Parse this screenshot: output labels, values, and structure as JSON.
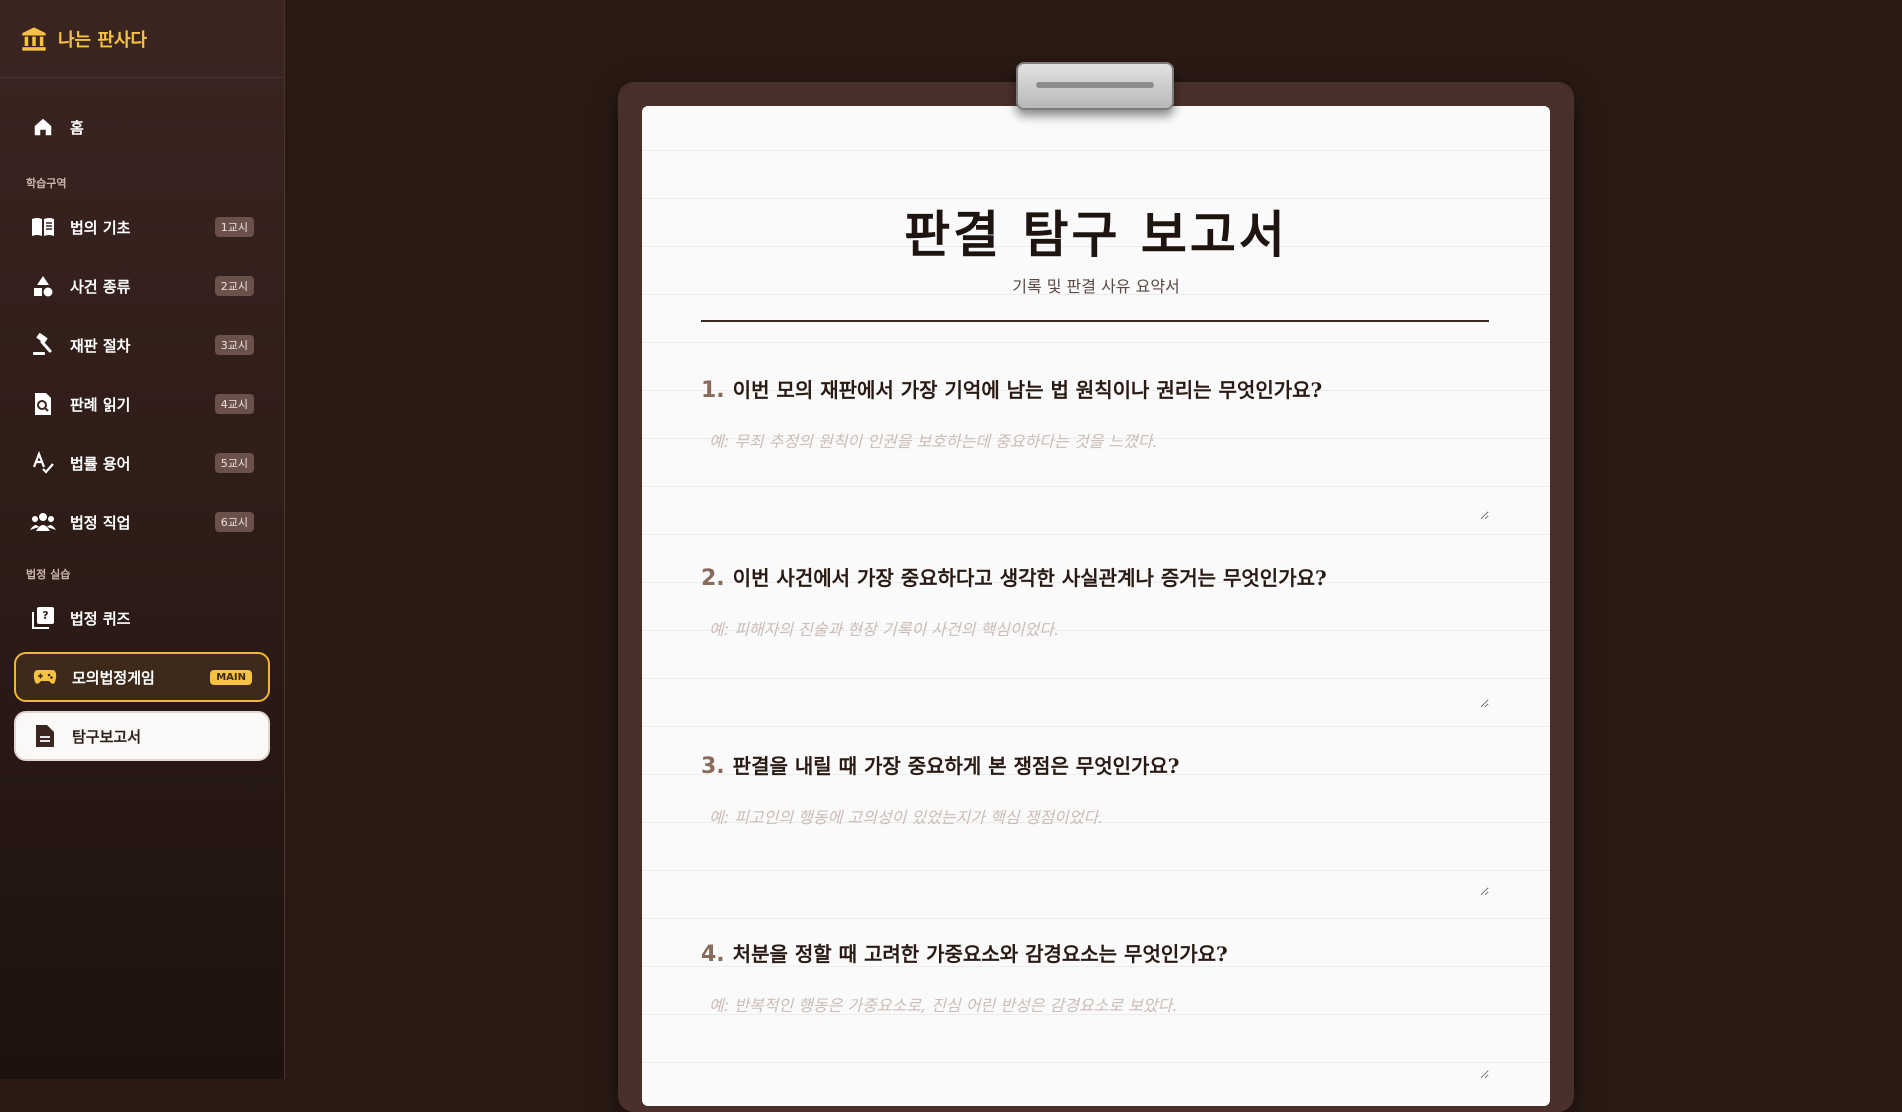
{
  "brand": {
    "title": "나는 판사다"
  },
  "nav": {
    "home": "홈",
    "section_study": "학습구역",
    "section_practice": "법정 실습",
    "items": [
      {
        "label": "법의 기초",
        "badge": "1교시"
      },
      {
        "label": "사건 종류",
        "badge": "2교시"
      },
      {
        "label": "재판 절차",
        "badge": "3교시"
      },
      {
        "label": "판례 읽기",
        "badge": "4교시"
      },
      {
        "label": "법률 용어",
        "badge": "5교시"
      },
      {
        "label": "법정 직업",
        "badge": "6교시"
      }
    ],
    "quiz": "법정 퀴즈",
    "game": {
      "label": "모의법정게임",
      "badge": "MAIN"
    },
    "report": "탐구보고서"
  },
  "report": {
    "title": "판결 탐구 보고서",
    "subtitle": "기록 및 판결 사유 요약서",
    "questions": [
      {
        "num": "1.",
        "text": "이번 모의 재판에서 가장 기억에 남는 법 원칙이나 권리는 무엇인가요?",
        "placeholder": "예: 무죄 추정의 원칙이 인권을 보호하는데 중요하다는 것을 느꼈다."
      },
      {
        "num": "2.",
        "text": "이번 사건에서 가장 중요하다고 생각한 사실관계나 증거는 무엇인가요?",
        "placeholder": "예: 피해자의 진술과 현장 기록이 사건의 핵심이었다."
      },
      {
        "num": "3.",
        "text": "판결을 내릴 때 가장 중요하게 본 쟁점은 무엇인가요?",
        "placeholder": "예: 피고인의 행동에 고의성이 있었는지가 핵심 쟁점이었다."
      },
      {
        "num": "4.",
        "text": "처분을 정할 때 고려한 가중요소와 감경요소는 무엇인가요?",
        "placeholder": "예: 반복적인 행동은 가중요소로, 진심 어린 반성은 감경요소로 보았다."
      }
    ]
  },
  "colors": {
    "accent": "#f6c244",
    "sidebar_bg": "#2f1d18",
    "board": "#4a302a",
    "paper": "#fafafa"
  },
  "icons": [
    "bank-icon",
    "home-icon",
    "book-icon",
    "shapes-icon",
    "gavel-icon",
    "search-doc-icon",
    "spellcheck-icon",
    "people-icon",
    "quiz-icon",
    "gamepad-icon",
    "document-icon"
  ]
}
